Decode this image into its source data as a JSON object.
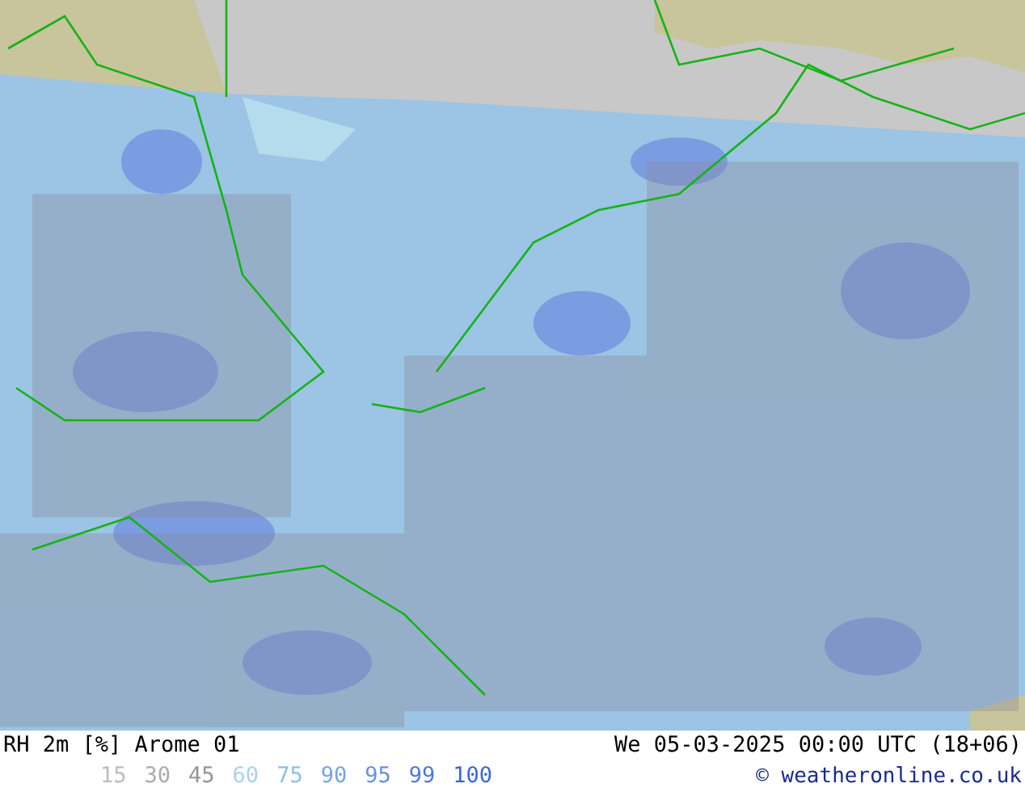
{
  "caption": {
    "title": "RH 2m [%] Arome 01",
    "datetime": "We 05-03-2025 00:00 UTC (18+06)"
  },
  "legend": [
    {
      "label": "15",
      "color": "#bdbdbd"
    },
    {
      "label": "30",
      "color": "#acacac"
    },
    {
      "label": "45",
      "color": "#969696"
    },
    {
      "label": "60",
      "color": "#a8d4ec"
    },
    {
      "label": "75",
      "color": "#8cc0e8"
    },
    {
      "label": "90",
      "color": "#78a4e4"
    },
    {
      "label": "95",
      "color": "#6890e0"
    },
    {
      "label": "99",
      "color": "#5078e0"
    },
    {
      "label": "100",
      "color": "#3c64dc"
    }
  ],
  "credit": "© weatheronline.co.uk"
}
